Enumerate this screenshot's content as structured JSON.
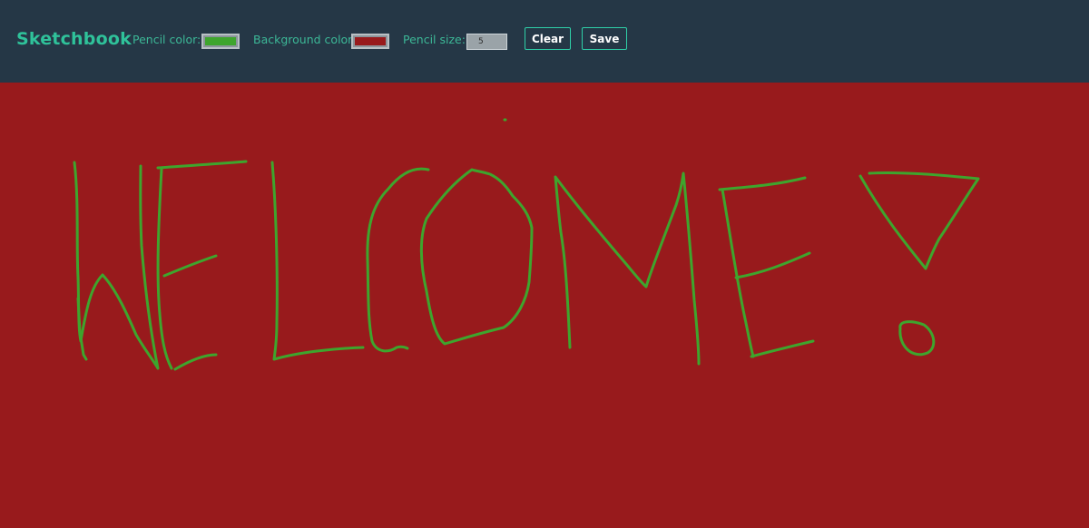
{
  "app": {
    "title": "Sketchbook"
  },
  "toolbar": {
    "pencil_color_label": "Pencil color:",
    "pencil_color_value": "#3ea52d",
    "background_color_label": "Background color:",
    "background_color_value": "#981a1c",
    "pencil_size_label": "Pencil size:",
    "pencil_size_value": "5",
    "clear_label": "Clear",
    "save_label": "Save"
  },
  "colors": {
    "toolbar_bg": "#253746",
    "accent": "#2fd0a8",
    "title_text": "#2fc29a",
    "label_text": "#3cb897",
    "canvas_bg": "#981a1c",
    "stroke": "#3ea52d"
  },
  "canvas": {
    "drawing": "handwritten WELCOME!"
  }
}
